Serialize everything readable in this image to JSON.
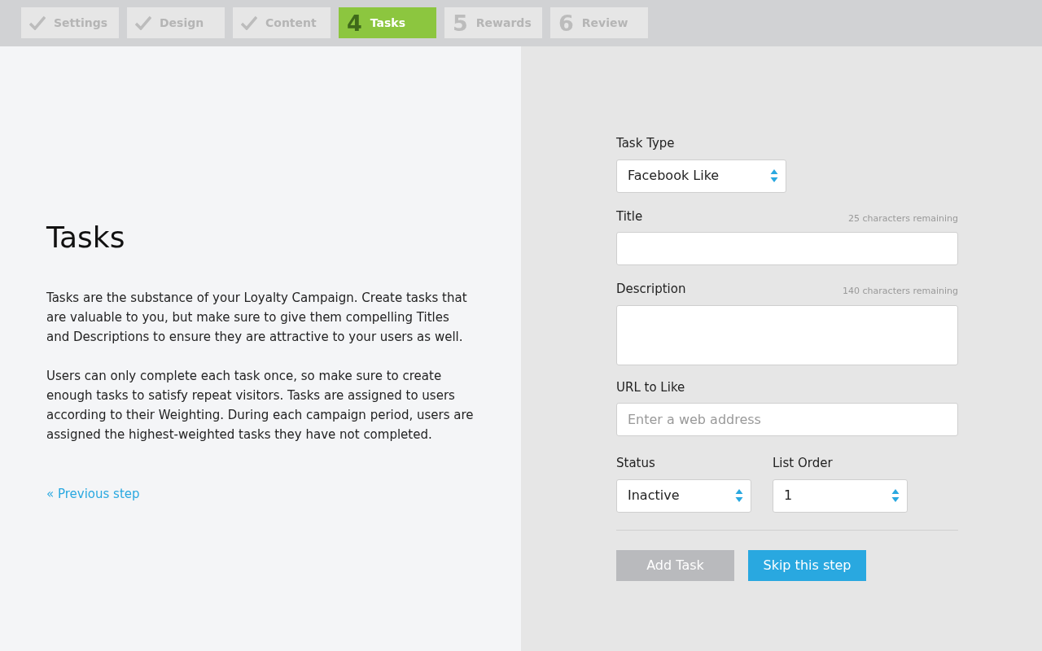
{
  "steps": [
    {
      "label": "Settings",
      "done": true,
      "selected": false
    },
    {
      "label": "Design",
      "done": true,
      "selected": false
    },
    {
      "label": "Content",
      "done": true,
      "selected": false
    },
    {
      "label": "Tasks",
      "number": "4",
      "done": false,
      "selected": true
    },
    {
      "label": "Rewards",
      "number": "5",
      "done": false,
      "selected": false
    },
    {
      "label": "Review",
      "number": "6",
      "done": false,
      "selected": false
    }
  ],
  "intro": {
    "heading": "Tasks",
    "paragraphs": [
      "Tasks are the substance of your Loyalty Campaign. Create tasks that are valuable to you, but make sure to give them compelling Titles and Descriptions to ensure they are attractive to your users as well.",
      "Users can only complete each task once, so make sure to create enough tasks to satisfy repeat visitors. Tasks are assigned to users according to their Weighting. During each campaign period, users are assigned the highest-weighted tasks they have not completed."
    ],
    "previous_link": "« Previous step"
  },
  "form": {
    "task_type": {
      "label": "Task Type",
      "value": "Facebook Like"
    },
    "title": {
      "label": "Title",
      "counter": "25 characters remaining"
    },
    "description": {
      "label": "Description",
      "counter": "140 characters remaining"
    },
    "url": {
      "label": "URL to Like",
      "placeholder": "Enter a web address"
    },
    "status": {
      "label": "Status",
      "value": "Inactive"
    },
    "list_order": {
      "label": "List Order",
      "value": "1"
    },
    "buttons": [
      {
        "label": "Add Task",
        "disabled": true
      },
      {
        "label": "Skip this step",
        "disabled": false
      }
    ]
  }
}
